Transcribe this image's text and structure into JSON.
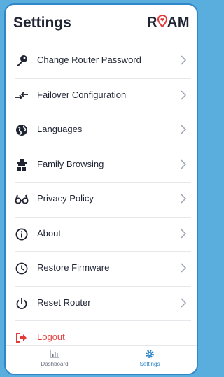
{
  "header": {
    "title": "Settings",
    "logo_left": "R",
    "logo_pin": "♥",
    "logo_right": "AM"
  },
  "menu": [
    {
      "label": "Change Router Password",
      "icon": "key-icon"
    },
    {
      "label": "Failover Configuration",
      "icon": "failover-arrows-icon"
    },
    {
      "label": "Languages",
      "icon": "globe-icon"
    },
    {
      "label": "Family Browsing",
      "icon": "family-icon"
    },
    {
      "label": "Privacy Policy",
      "icon": "glasses-icon"
    },
    {
      "label": "About",
      "icon": "info-icon"
    },
    {
      "label": "Restore Firmware",
      "icon": "clock-icon"
    },
    {
      "label": "Reset Router",
      "icon": "power-icon"
    },
    {
      "label": "Logout",
      "icon": "logout-icon"
    }
  ],
  "tabbar": {
    "dashboard_label": "Dashboard",
    "settings_label": "Settings",
    "active": "Settings"
  },
  "colors": {
    "background": "#5aaede",
    "accent": "#2f86c8",
    "logout": "#e23b3b",
    "text": "#1f2433"
  }
}
